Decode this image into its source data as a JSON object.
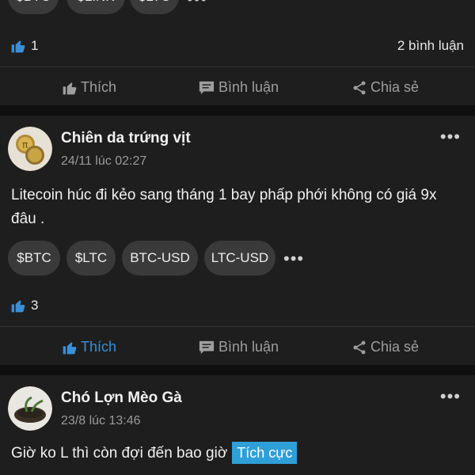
{
  "post1": {
    "tags": [
      "$BTC",
      "$LINK",
      "$LTC"
    ],
    "likes": "1",
    "comments_count": "2 bình luận",
    "actions": {
      "like": "Thích",
      "comment": "Bình luận",
      "share": "Chia sẻ"
    }
  },
  "post2": {
    "author": "Chiên da trứng vịt",
    "time": "24/11 lúc 02:27",
    "text": "Litecoin húc đi kẻo sang tháng 1 bay phấp phới không có giá 9x đâu .",
    "tags": [
      "$BTC",
      "$LTC",
      "BTC-USD",
      "LTC-USD"
    ],
    "likes": "3",
    "actions": {
      "like": "Thích",
      "comment": "Bình luận",
      "share": "Chia sẻ"
    },
    "liked": true
  },
  "post3": {
    "author": "Chó Lợn Mèo Gà",
    "time": "23/8 lúc 13:46",
    "text": "Giờ ko L thì còn đợi đến bao giờ",
    "sentiment": "Tích cực"
  },
  "colors": {
    "background": "#0f0f0f",
    "card": "#1e1e1e",
    "chip": "#3a3a3a",
    "accent": "#3b8fd6",
    "sentiment": "#2f9fd8",
    "muted": "#9e9e9e"
  },
  "icons": [
    "thumbs-up-icon",
    "comment-icon",
    "share-icon",
    "more-icon"
  ]
}
